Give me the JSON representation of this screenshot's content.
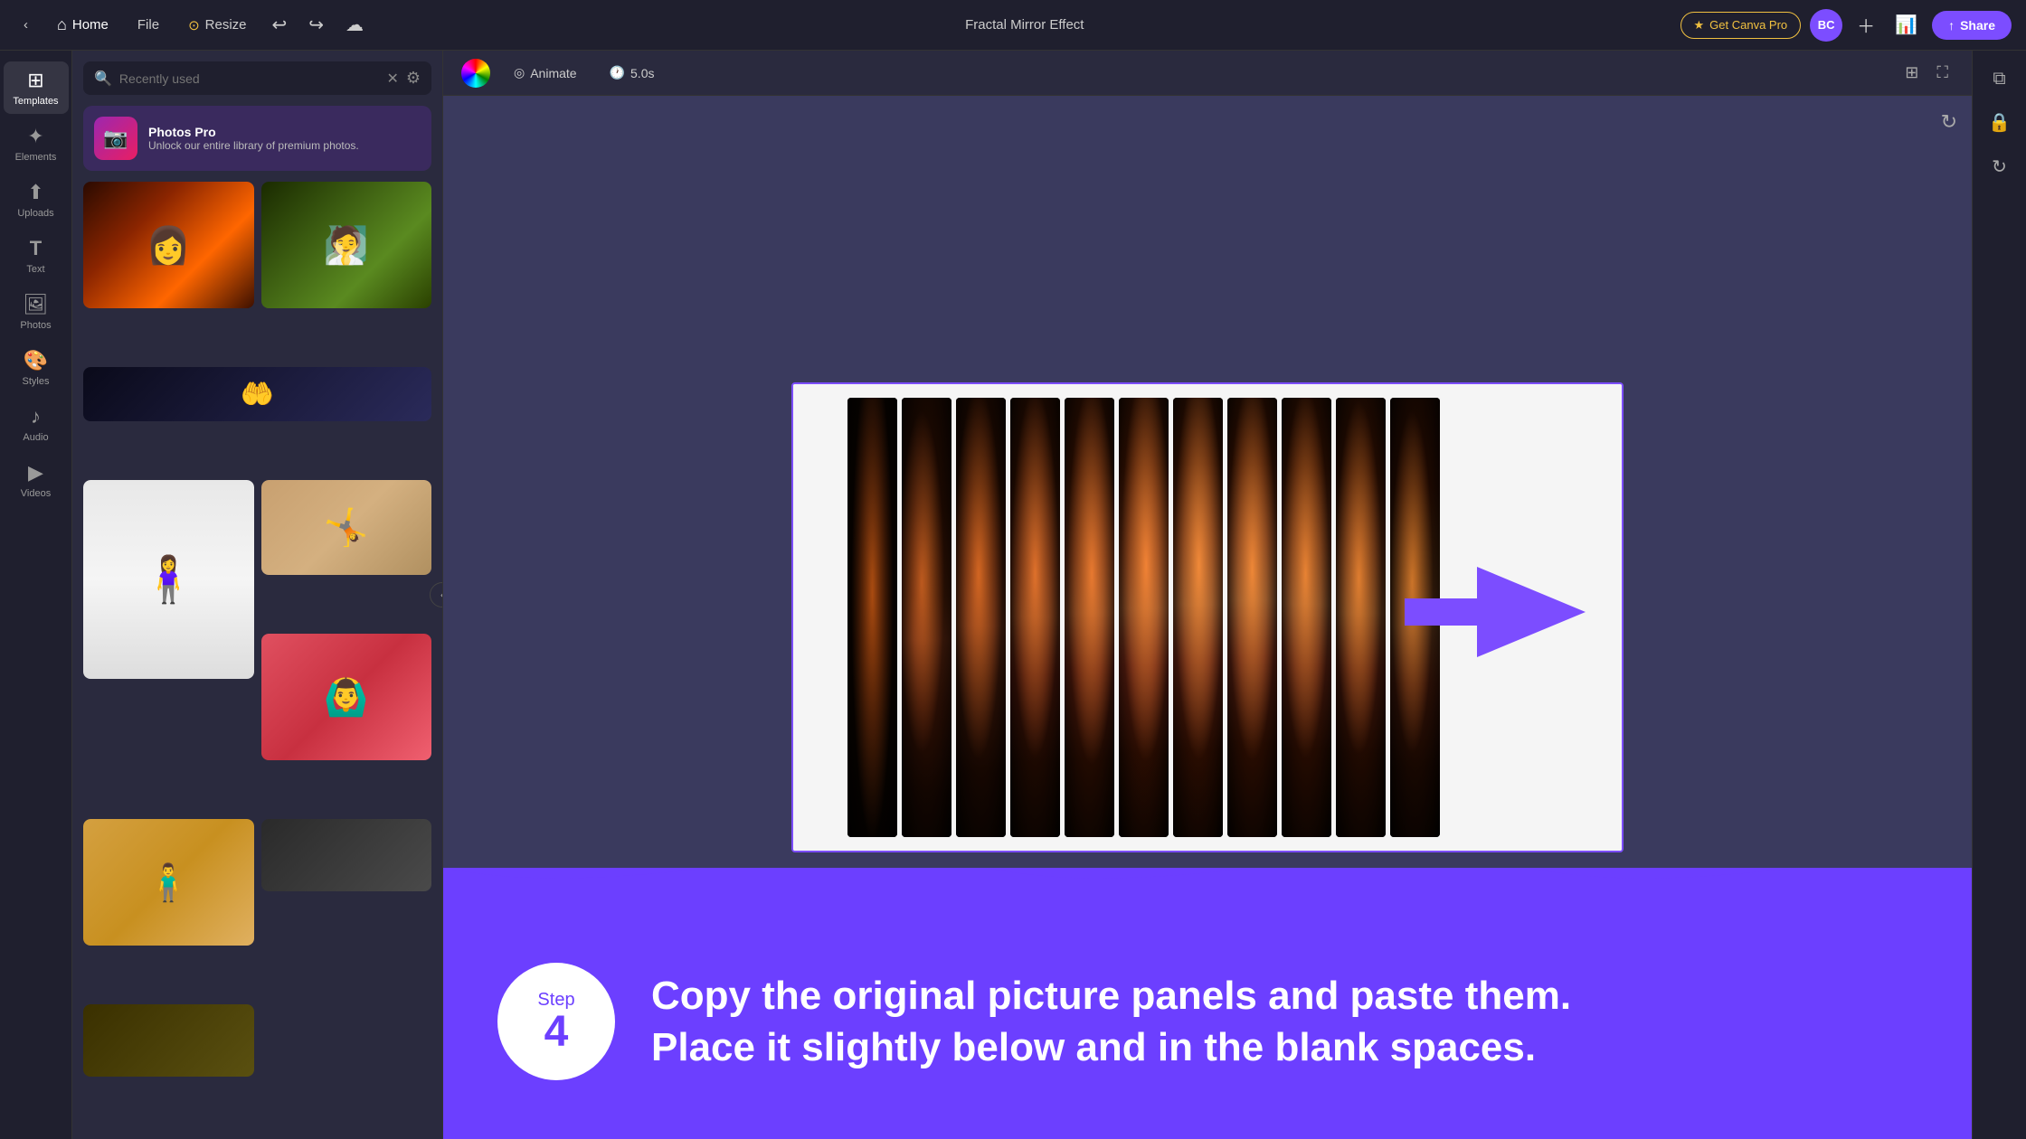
{
  "app": {
    "title": "Fractal Mirror Effect"
  },
  "topnav": {
    "home_label": "Home",
    "file_label": "File",
    "resize_label": "Resize",
    "canvapro_label": "Get Canva Pro",
    "share_label": "Share",
    "user_initials": "BC"
  },
  "sidebar": {
    "items": [
      {
        "id": "templates",
        "label": "Templates",
        "icon": "⊞"
      },
      {
        "id": "elements",
        "label": "Elements",
        "icon": "✦"
      },
      {
        "id": "uploads",
        "label": "Uploads",
        "icon": "↑"
      },
      {
        "id": "text",
        "label": "Text",
        "icon": "T"
      },
      {
        "id": "photos",
        "label": "Photos",
        "icon": "🖼"
      },
      {
        "id": "styles",
        "label": "Styles",
        "icon": "🎨"
      },
      {
        "id": "audio",
        "label": "Audio",
        "icon": "♪"
      },
      {
        "id": "videos",
        "label": "Videos",
        "icon": "▶"
      }
    ]
  },
  "panel": {
    "search_placeholder": "Recently used",
    "photos_pro": {
      "title": "Photos Pro",
      "subtitle": "Unlock our entire library of premium photos."
    }
  },
  "canvas_toolbar": {
    "animate_label": "Animate",
    "duration_label": "5.0s"
  },
  "bottom": {
    "step_label": "Step",
    "step_number": "4",
    "instruction_line1": "Copy the original picture panels and paste them.",
    "instruction_line2": "Place it slightly below and in the blank spaces."
  },
  "colors": {
    "accent": "#7c4dff",
    "purple_bg": "#6c3fff",
    "pro_gold": "#f0c040"
  }
}
